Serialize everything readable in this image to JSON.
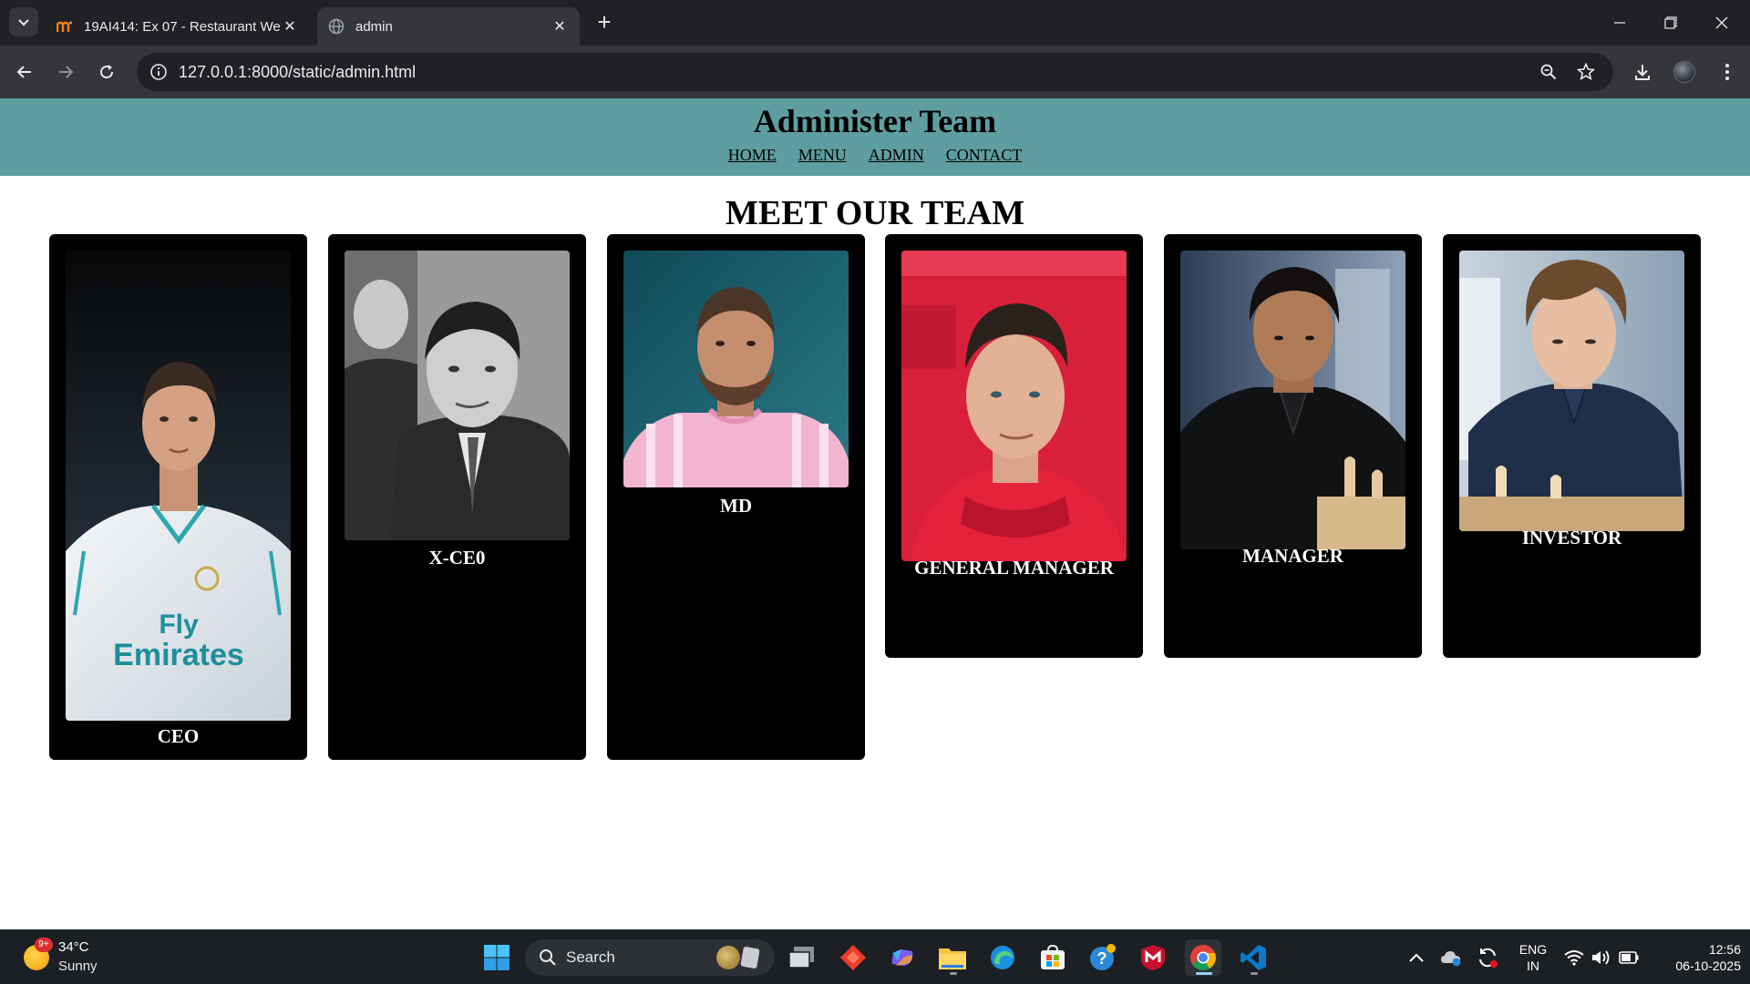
{
  "browser": {
    "tabs": [
      {
        "title": "19AI414: Ex 07 - Restaurant We",
        "active": false,
        "favicon": "moodle-icon"
      },
      {
        "title": "admin",
        "active": true,
        "favicon": "globe-icon"
      }
    ],
    "url": "127.0.0.1:8000/static/admin.html"
  },
  "page": {
    "header": {
      "title": "Administer Team",
      "nav": [
        "HOME",
        "MENU",
        "ADMIN",
        "CONTACT"
      ]
    },
    "team_heading": "MEET OUR TEAM",
    "members": [
      {
        "role": "CEO",
        "photo": "portrait-footballer-white-jersey"
      },
      {
        "role": "X-CE0",
        "photo": "portrait-black-and-white-man-in-suit"
      },
      {
        "role": "MD",
        "photo": "portrait-footballer-pink-jersey"
      },
      {
        "role": "GENERAL MANAGER",
        "photo": "portrait-man-red-top"
      },
      {
        "role": "MANAGER",
        "photo": "portrait-man-black-shirt-chess"
      },
      {
        "role": "INVESTOR",
        "photo": "portrait-man-navy-shirt-chess"
      }
    ],
    "shirt_print": {
      "brand": "Fly",
      "brand2": "Emirates"
    }
  },
  "taskbar": {
    "weather": {
      "temp": "34°C",
      "condition": "Sunny",
      "badge": "9+"
    },
    "search_label": "Search",
    "language": {
      "line1": "ENG",
      "line2": "IN"
    },
    "clock": {
      "time": "12:56",
      "date": "06-10-2025"
    }
  },
  "colors": {
    "header_bg": "#5f9ea0",
    "card_bg": "#000000",
    "chrome_dark": "#202124",
    "chrome_toolbar": "#35363a"
  }
}
